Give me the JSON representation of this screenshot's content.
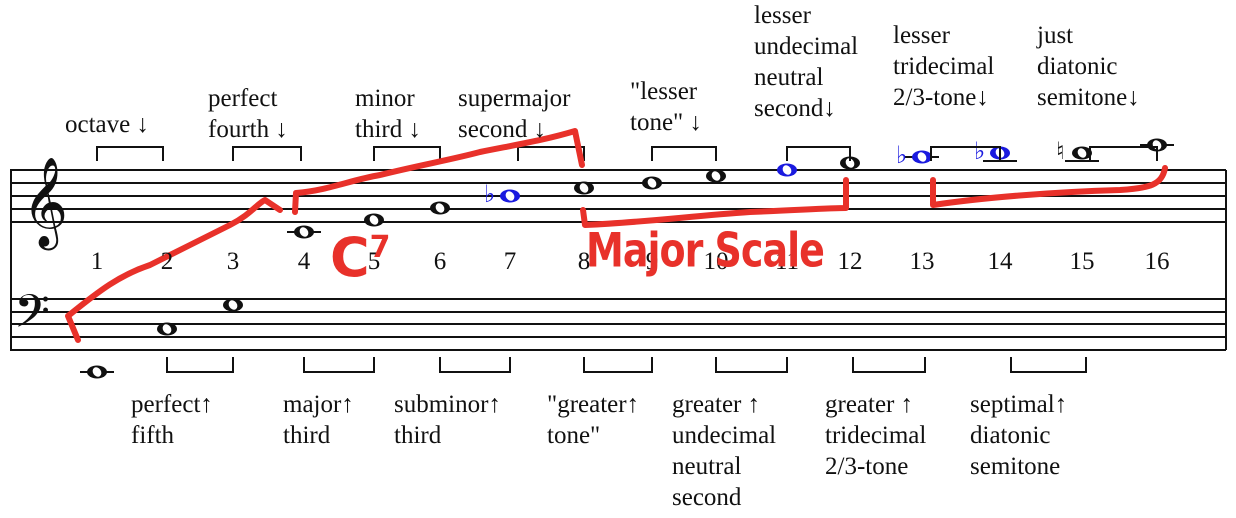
{
  "title": "",
  "top_labels": [
    {
      "text": "octave ↓"
    },
    {
      "text": "perfect\nfourth ↓"
    },
    {
      "text": "minor\nthird ↓"
    },
    {
      "text": "supermajor\nsecond ↓"
    },
    {
      "text": "\"lesser\ntone\" ↓"
    },
    {
      "text": "lesser\nundecimal\nneutral\nsecond↓"
    },
    {
      "text": "lesser\ntridecimal\n2/3-tone↓"
    },
    {
      "text": "just\ndiatonic\nsemitone↓"
    }
  ],
  "bottom_labels": [
    {
      "text": "perfect↑\nfifth"
    },
    {
      "text": "major↑\nthird"
    },
    {
      "text": "subminor↑\nthird"
    },
    {
      "text": "\"greater↑\ntone\""
    },
    {
      "text": "greater ↑\nundecimal\nneutral\nsecond"
    },
    {
      "text": "greater ↑\ntridecimal\n2/3-tone"
    },
    {
      "text": "septimal↑\ndiatonic\nsemitone"
    }
  ],
  "harmonic_numbers": [
    "1",
    "2",
    "3",
    "4",
    "5",
    "6",
    "7",
    "8",
    "9",
    "10",
    "11",
    "12",
    "13",
    "14",
    "15",
    "16"
  ],
  "notes": [
    {
      "harmonic": 1,
      "color": "black",
      "accidental": ""
    },
    {
      "harmonic": 2,
      "color": "black",
      "accidental": ""
    },
    {
      "harmonic": 3,
      "color": "black",
      "accidental": ""
    },
    {
      "harmonic": 4,
      "color": "black",
      "accidental": ""
    },
    {
      "harmonic": 5,
      "color": "black",
      "accidental": ""
    },
    {
      "harmonic": 6,
      "color": "black",
      "accidental": ""
    },
    {
      "harmonic": 7,
      "color": "blue",
      "accidental": "flat"
    },
    {
      "harmonic": 8,
      "color": "black",
      "accidental": ""
    },
    {
      "harmonic": 9,
      "color": "black",
      "accidental": ""
    },
    {
      "harmonic": 10,
      "color": "black",
      "accidental": ""
    },
    {
      "harmonic": 11,
      "color": "blue",
      "accidental": ""
    },
    {
      "harmonic": 12,
      "color": "black",
      "accidental": ""
    },
    {
      "harmonic": 13,
      "color": "blue",
      "accidental": "flat"
    },
    {
      "harmonic": 14,
      "color": "blue",
      "accidental": "flat"
    },
    {
      "harmonic": 15,
      "color": "black",
      "accidental": "natural"
    },
    {
      "harmonic": 16,
      "color": "black",
      "accidental": ""
    }
  ],
  "annotations": {
    "chord": "C",
    "chord_sup": "7",
    "scale": "Major Scale",
    "color": "#e8312a"
  },
  "colors": {
    "ink": "#111111",
    "blue_notes": "#1a1adf",
    "annotation": "#e8312a"
  }
}
